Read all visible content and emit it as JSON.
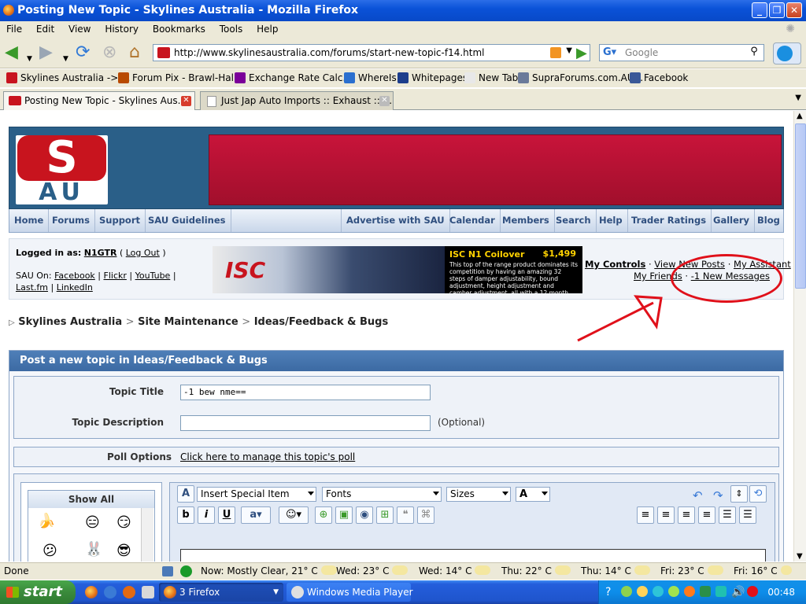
{
  "window": {
    "title": "Posting New Topic - Skylines Australia - Mozilla Firefox"
  },
  "menu": [
    "File",
    "Edit",
    "View",
    "History",
    "Bookmarks",
    "Tools",
    "Help"
  ],
  "address": {
    "url": "http://www.skylinesaustralia.com/forums/start-new-topic-f14.html"
  },
  "search": {
    "placeholder": "Google"
  },
  "bookmarks": [
    {
      "label": "Skylines Australia -> ...",
      "color": "#c8141e"
    },
    {
      "label": "Forum Pix - Brawl-Hall...",
      "color": "#b84a00"
    },
    {
      "label": "Exchange Rate Calc...",
      "color": "#7b0099"
    },
    {
      "label": "WhereIs",
      "color": "#2a6fcf"
    },
    {
      "label": "Whitepages",
      "color": "#1d3e8c"
    },
    {
      "label": "New Tab",
      "color": "#e8e8e8"
    },
    {
      "label": "SupraForums.com.AU...",
      "color": "#6a7a9a"
    },
    {
      "label": "Facebook",
      "color": "#3b5998"
    }
  ],
  "tabs": [
    {
      "label": "Posting New Topic - Skylines Aus...",
      "active": true
    },
    {
      "label": "Just Jap Auto Imports :: Exhaust :: E...",
      "active": false
    }
  ],
  "site": {
    "nav": [
      "Home",
      "Forums",
      "Support",
      "SAU Guidelines",
      "Advertise with SAU",
      "Calendar",
      "Members",
      "Search",
      "Help",
      "Trader Ratings",
      "Gallery",
      "Blog"
    ],
    "user": {
      "logged_in_label": "Logged in as:",
      "username": "N1GTR",
      "logout": "Log Out",
      "sau_on_label": "SAU On:",
      "social": [
        "Facebook",
        "Flickr",
        "YouTube",
        "Last.fm",
        "LinkedIn"
      ]
    },
    "ad": {
      "brand": "ISC",
      "title": "ISC N1 Coilover",
      "price": "$1,499",
      "desc": "This top of the range product dominates its competition by having an amazing 32 steps of damper adjustability, bound adjustment, height adjustment and camber adjustment, all with a 12 month warranty."
    },
    "links": {
      "my_controls": "My Controls",
      "view_new_posts": "View New Posts",
      "my_assistant": "My Assistant",
      "my_friends": "My Friends",
      "new_messages": "-1 New Messages"
    },
    "breadcrumb": [
      "Skylines Australia",
      "Site Maintenance",
      "Ideas/Feedback & Bugs"
    ],
    "post": {
      "header": "Post a new topic in Ideas/Feedback & Bugs",
      "topic_title_label": "Topic Title",
      "topic_title_value": "-1 bew nme==",
      "topic_desc_label": "Topic Description",
      "topic_desc_value": "",
      "optional": "(Optional)",
      "poll_label": "Poll Options",
      "poll_link": "Click here to manage this topic's poll",
      "show_all": "Show All",
      "special_item": "Insert Special Item",
      "fonts": "Fonts",
      "sizes": "Sizes"
    }
  },
  "status": {
    "text": "Done",
    "weather": [
      "Now: Mostly Clear, 21° C",
      "Wed: 23° C",
      "Wed: 14° C",
      "Thu: 22° C",
      "Thu: 14° C",
      "Fri: 23° C",
      "Fri: 16° C"
    ]
  },
  "taskbar": {
    "start": "start",
    "tasks": [
      "3 Firefox",
      "Windows Media Player"
    ],
    "clock": "00:48"
  }
}
